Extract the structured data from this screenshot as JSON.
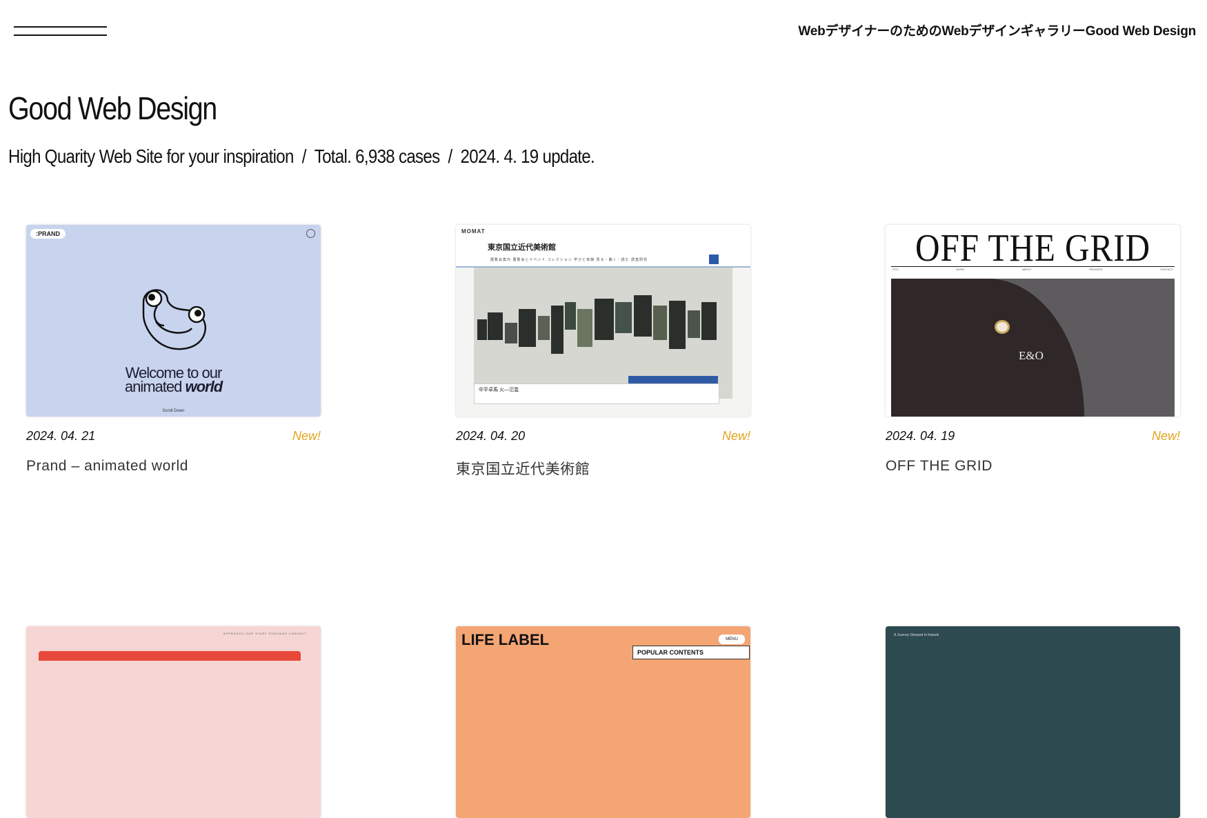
{
  "header": {
    "menu_icon": "hamburger-icon",
    "site_tagline": "WebデザイナーのためのWebデザインギャラリーGood Web Design"
  },
  "page": {
    "title": "Good Web Design",
    "subtitle_part1": "High Quarity Web Site for your inspiration",
    "subtitle_separator": "/",
    "subtitle_part2": "Total. 6,938 cases",
    "subtitle_part3": "2024. 4. 19 update."
  },
  "cards": [
    {
      "date": "2024. 04. 21",
      "badge": "New!",
      "title": "Prand – animated world",
      "thumb": {
        "logo": ":PRAND",
        "headline_line1": "Welcome to our",
        "headline_line2_prefix": "animated ",
        "headline_line2_emph": "world",
        "scroll": "Scroll Down"
      }
    },
    {
      "date": "2024. 04. 20",
      "badge": "New!",
      "title": "東京国立近代美術館",
      "thumb": {
        "logo": "MOMAT",
        "name": "東京国立近代美術館",
        "nav": "展覧会案内 展覧会とイベント コレクション 学びと体験 見る・聴く・読む 調査研究",
        "caption": "中平卓馬 火―氾濫"
      }
    },
    {
      "date": "2024. 04. 19",
      "badge": "New!",
      "title": "OFF THE GRID",
      "thumb": {
        "headline": "OFF THE GRID",
        "nav": [
          "OTG",
          "WORK",
          "ABOUT",
          "PROCESS",
          "CONTACT"
        ],
        "monogram": "E&O"
      }
    }
  ],
  "cards_row2": [
    {
      "nav": "APPROACH OUR STAFF FINDINGS CONTACT"
    },
    {
      "label": "LIFE LABEL",
      "popular": "POPULAR CONTENTS",
      "menu": "MENU"
    },
    {
      "intro": "A Journey Steeped In Kaiseki"
    }
  ],
  "colors": {
    "new_badge": "#e2a51f",
    "prand_bg": "#c8d3ee",
    "museum_accent": "#2d5aa8"
  }
}
